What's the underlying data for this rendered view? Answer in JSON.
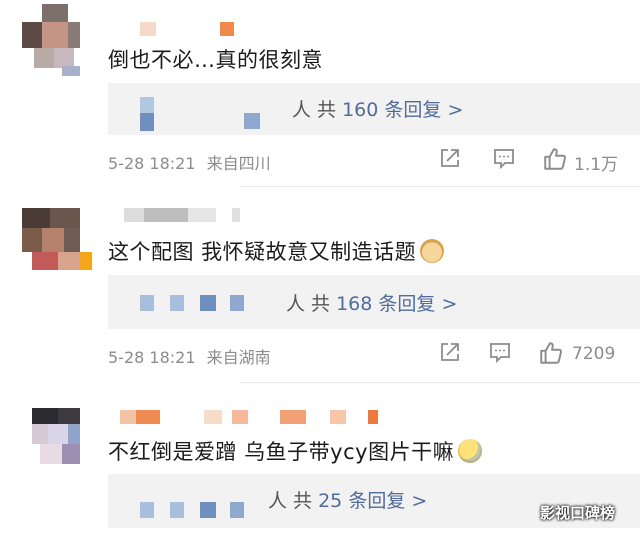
{
  "comments": [
    {
      "text": "倒也不必…真的很刻意",
      "reply_prefix": "等人",
      "reply_main": "人 共",
      "reply_count": "160",
      "reply_suffix": "条回复 >",
      "time": "5-28 18:21",
      "location": "来自四川",
      "likes": "1.1万"
    },
    {
      "text": "这个配图 我怀疑故意又制造话题",
      "emoji": "doge-emoji",
      "reply_main": "人 共",
      "reply_count": "168",
      "reply_suffix": "条回复 >",
      "time": "5-28 18:21",
      "location": "来自湖南",
      "likes": "7209"
    },
    {
      "text": "不红倒是爱蹭 乌鱼子带ycy图片干嘛",
      "emoji": "sweat-emoji",
      "reply_main": "人 共",
      "reply_count": "25",
      "reply_suffix": "条回复 >"
    }
  ],
  "watermark": "影视口碑榜",
  "colors": {
    "link_blue": "#506c9b",
    "meta_gray": "#8c8c8c",
    "reply_bg": "#f2f2f2"
  }
}
